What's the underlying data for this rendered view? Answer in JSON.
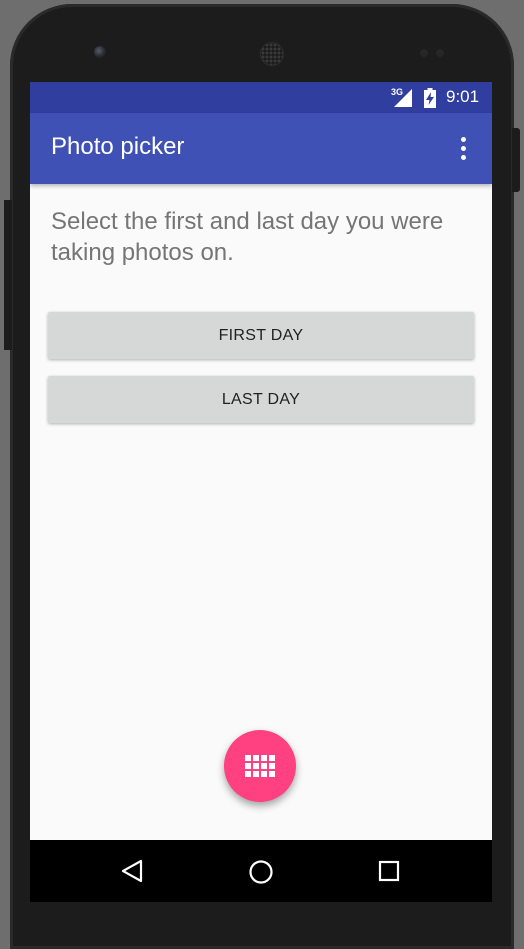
{
  "status_bar": {
    "network": "3G",
    "time": "9:01"
  },
  "app_bar": {
    "title": "Photo picker",
    "overflow_icon": "more-vert-icon"
  },
  "main": {
    "prompt": "Select the first and last day you were taking photos on.",
    "first_day_button": "FIRST DAY",
    "last_day_button": "LAST DAY"
  },
  "fab": {
    "icon": "grid-apps-icon",
    "color": "#ff4081"
  },
  "nav_bar": {
    "back_icon": "back-triangle-icon",
    "home_icon": "home-circle-icon",
    "recents_icon": "recents-square-icon"
  },
  "colors": {
    "primary": "#3f51b5",
    "primary_dark": "#303f9f",
    "accent": "#ff4081",
    "button": "#d6d7d7"
  }
}
